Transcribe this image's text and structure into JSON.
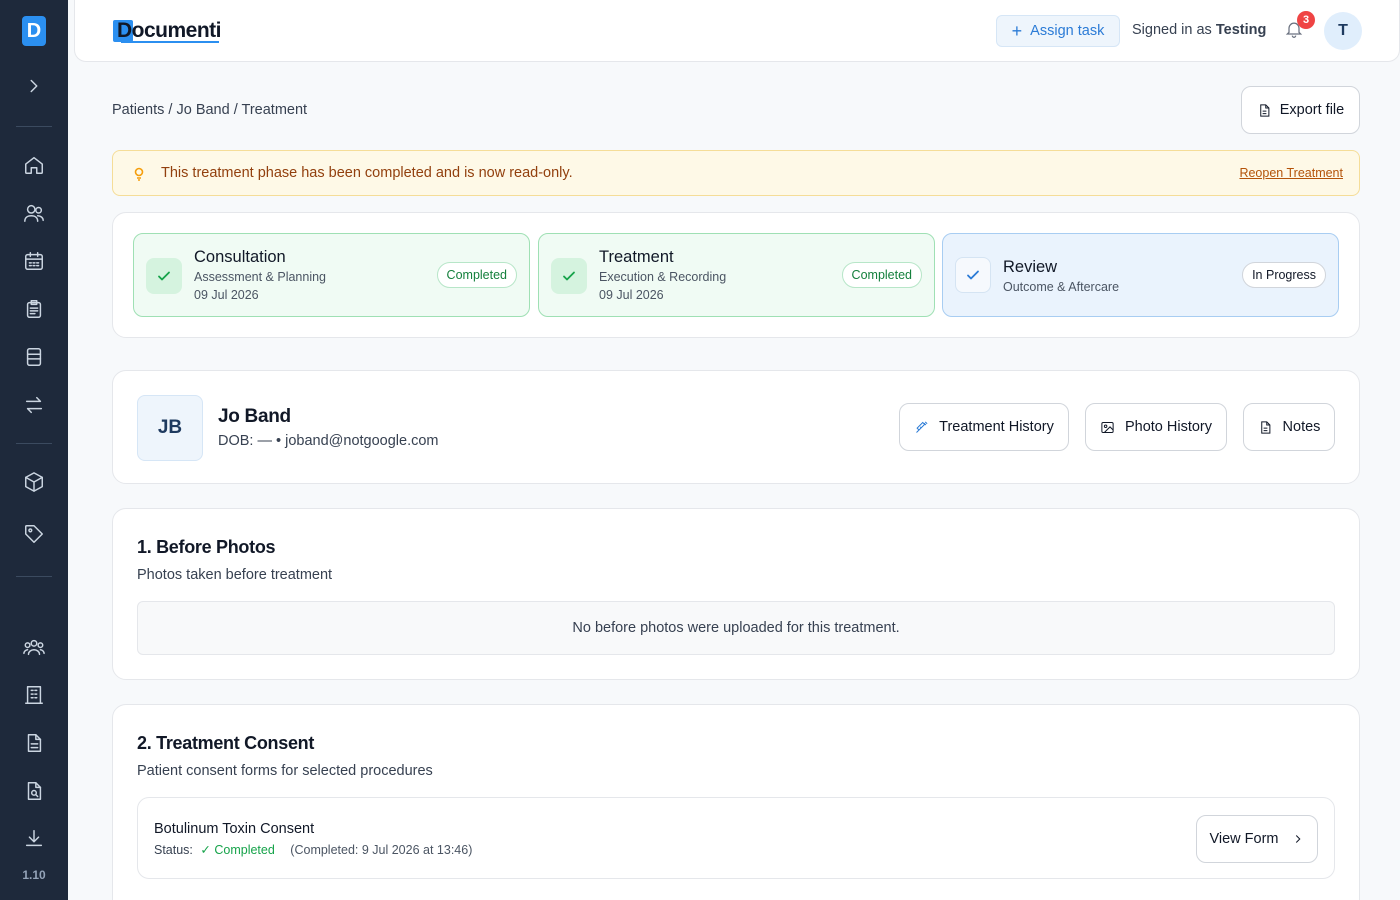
{
  "sidebar": {
    "logo_letter": "D",
    "version": "1.10",
    "items": [
      {
        "icon": "chevron-right-icon",
        "name": "expand-sidebar-button"
      },
      {
        "icon": "home-icon",
        "name": "sidebar-item-home"
      },
      {
        "icon": "users-icon",
        "name": "sidebar-item-patients"
      },
      {
        "icon": "calendar-icon",
        "name": "sidebar-item-calendar"
      },
      {
        "icon": "clipboard-icon",
        "name": "sidebar-item-tasks"
      },
      {
        "icon": "layout-icon",
        "name": "sidebar-item-templates"
      },
      {
        "icon": "transfer-icon",
        "name": "sidebar-item-transfers"
      },
      {
        "icon": "box-icon",
        "name": "sidebar-item-inventory"
      },
      {
        "icon": "tag-icon",
        "name": "sidebar-item-pricing"
      },
      {
        "icon": "team-icon",
        "name": "sidebar-item-team"
      },
      {
        "icon": "building-icon",
        "name": "sidebar-item-clinics"
      },
      {
        "icon": "document-icon",
        "name": "sidebar-item-documents"
      },
      {
        "icon": "document-search-icon",
        "name": "sidebar-item-audit"
      },
      {
        "icon": "download-icon",
        "name": "sidebar-item-downloads"
      }
    ]
  },
  "header": {
    "logo_text": "Documenti",
    "assign_task_label": "Assign task",
    "signed_in_prefix": "Signed in as",
    "signed_in_user": "Testing",
    "notification_count": "3",
    "avatar_initial": "T"
  },
  "breadcrumb": "Patients / Jo Band / Treatment",
  "export_label": "Export file",
  "alert": {
    "message": "This treatment phase has been completed and is now read-only.",
    "action": "Reopen Treatment"
  },
  "steps": [
    {
      "title": "Consultation",
      "subtitle": "Assessment & Planning",
      "date": "09 Jul 2026",
      "status": "Completed"
    },
    {
      "title": "Treatment",
      "subtitle": "Execution & Recording",
      "date": "09 Jul 2026",
      "status": "Completed"
    },
    {
      "title": "Review",
      "subtitle": "Outcome & Aftercare",
      "status": "In Progress"
    }
  ],
  "patient": {
    "initials": "JB",
    "name": "Jo Band",
    "meta": "DOB: — • joband@notgoogle.com",
    "buttons": {
      "treatment_history": "Treatment History",
      "photo_history": "Photo History",
      "notes": "Notes"
    }
  },
  "sections": {
    "before_photos": {
      "title": "1. Before Photos",
      "subtitle": "Photos taken before treatment",
      "empty": "No before photos were uploaded for this treatment."
    },
    "consent": {
      "title": "2. Treatment Consent",
      "subtitle": "Patient consent forms for selected procedures",
      "form_name": "Botulinum Toxin Consent",
      "status_label": "Status:",
      "status_value": "✓ Completed",
      "status_note": "(Completed: 9 Jul 2026 at 13:46)",
      "view_form": "View Form"
    }
  },
  "colors": {
    "sidebar_bg": "#1e293b",
    "brand_blue": "#2b8ff0",
    "success_green": "#16a34a",
    "alert_bg": "#fef9e7",
    "badge_red": "#ef4444"
  }
}
